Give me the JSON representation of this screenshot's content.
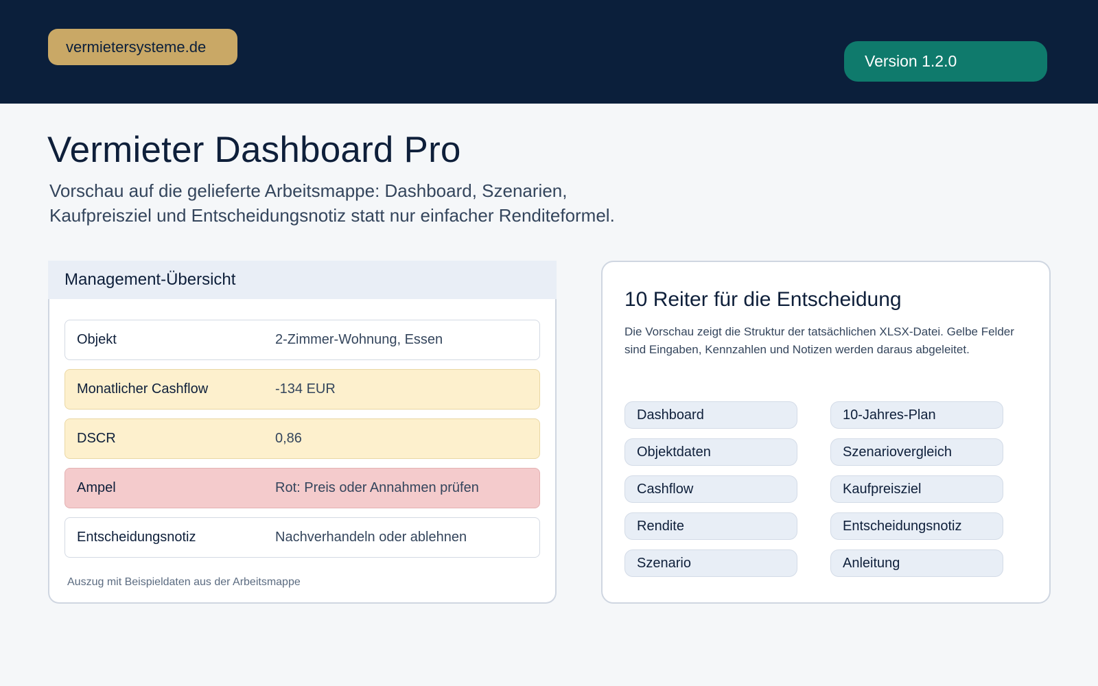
{
  "header": {
    "brand": "vermietersysteme.de",
    "version": "Version 1.2.0"
  },
  "hero": {
    "title": "Vermieter Dashboard Pro",
    "subtitle_line1": "Vorschau auf die gelieferte Arbeitsmappe: Dashboard, Szenarien,",
    "subtitle_line2": "Kaufpreisziel und Entscheidungsnotiz statt nur einfacher Renditeformel."
  },
  "overview": {
    "title": "Management-Übersicht",
    "rows": [
      {
        "key": "Objekt",
        "value": "2-Zimmer-Wohnung, Essen",
        "status": "neutral"
      },
      {
        "key": "Monatlicher Cashflow",
        "value": "-134 EUR",
        "status": "warning"
      },
      {
        "key": "DSCR",
        "value": "0,86",
        "status": "warning"
      },
      {
        "key": "Ampel",
        "value": "Rot: Preis oder Annahmen prüfen",
        "status": "critical"
      },
      {
        "key": "Entscheidungsnotiz",
        "value": "Nachverhandeln oder ablehnen",
        "status": "neutral"
      }
    ],
    "footnote": "Auszug mit Beispieldaten aus der Arbeitsmappe"
  },
  "tabs_panel": {
    "title": "10 Reiter für die Entscheidung",
    "description": "Die Vorschau zeigt die Struktur der tatsächlichen XLSX-Datei. Gelbe Felder sind Eingaben, Kennzahlen und Notizen werden daraus abgeleitet.",
    "tabs": [
      "Dashboard",
      "10-Jahres-Plan",
      "Objektdaten",
      "Szenariovergleich",
      "Cashflow",
      "Kaufpreisziel",
      "Rendite",
      "Entscheidungsnotiz",
      "Szenario",
      "Anleitung"
    ]
  },
  "colors": {
    "header_bg": "#0b1f3b",
    "brand_pill": "#c9a866",
    "version_pill": "#0f7a6c",
    "warning_bg": "#fdf0cd",
    "critical_bg": "#f4cbcc"
  }
}
